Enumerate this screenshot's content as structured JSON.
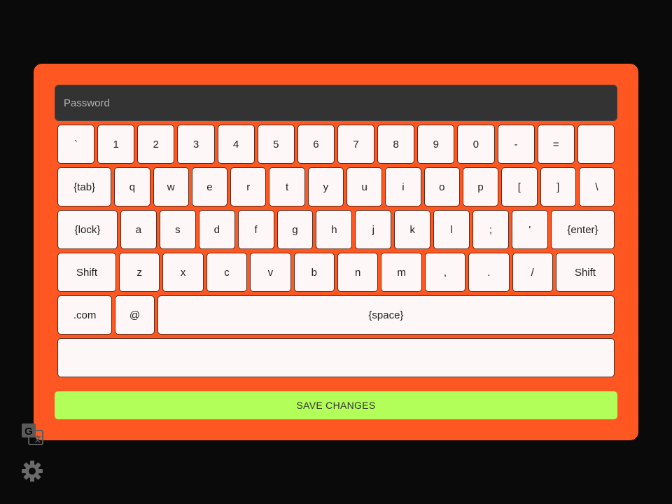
{
  "password": {
    "placeholder": "Password"
  },
  "keyboard": {
    "rows": [
      [
        {
          "label": "`",
          "w": 1
        },
        {
          "label": "1",
          "w": 1
        },
        {
          "label": "2",
          "w": 1
        },
        {
          "label": "3",
          "w": 1
        },
        {
          "label": "4",
          "w": 1
        },
        {
          "label": "5",
          "w": 1
        },
        {
          "label": "6",
          "w": 1
        },
        {
          "label": "7",
          "w": 1
        },
        {
          "label": "8",
          "w": 1
        },
        {
          "label": "9",
          "w": 1
        },
        {
          "label": "0",
          "w": 1
        },
        {
          "label": "-",
          "w": 1
        },
        {
          "label": "=",
          "w": 1
        },
        {
          "label": "",
          "w": 1
        }
      ],
      [
        {
          "label": "{tab}",
          "w": 1.45
        },
        {
          "label": "q",
          "w": 0.95
        },
        {
          "label": "w",
          "w": 0.95
        },
        {
          "label": "e",
          "w": 0.95
        },
        {
          "label": "r",
          "w": 0.95
        },
        {
          "label": "t",
          "w": 0.95
        },
        {
          "label": "y",
          "w": 0.95
        },
        {
          "label": "u",
          "w": 0.95
        },
        {
          "label": "i",
          "w": 0.95
        },
        {
          "label": "o",
          "w": 0.95
        },
        {
          "label": "p",
          "w": 0.95
        },
        {
          "label": "[",
          "w": 0.95
        },
        {
          "label": "]",
          "w": 0.95
        },
        {
          "label": "\\",
          "w": 0.95
        }
      ],
      [
        {
          "label": "{lock}",
          "w": 1.6
        },
        {
          "label": "a",
          "w": 0.95
        },
        {
          "label": "s",
          "w": 0.95
        },
        {
          "label": "d",
          "w": 0.95
        },
        {
          "label": "f",
          "w": 0.95
        },
        {
          "label": "g",
          "w": 0.95
        },
        {
          "label": "h",
          "w": 0.95
        },
        {
          "label": "j",
          "w": 0.95
        },
        {
          "label": "k",
          "w": 0.95
        },
        {
          "label": "l",
          "w": 0.95
        },
        {
          "label": ";",
          "w": 0.95
        },
        {
          "label": "'",
          "w": 0.95
        },
        {
          "label": "{enter}",
          "w": 1.7
        }
      ],
      [
        {
          "label": "Shift",
          "w": 1.6
        },
        {
          "label": "z",
          "w": 1.1
        },
        {
          "label": "x",
          "w": 1.1
        },
        {
          "label": "c",
          "w": 1.1
        },
        {
          "label": "v",
          "w": 1.1
        },
        {
          "label": "b",
          "w": 1.1
        },
        {
          "label": "n",
          "w": 1.1
        },
        {
          "label": "m",
          "w": 1.1
        },
        {
          "label": ",",
          "w": 1.1
        },
        {
          "label": ".",
          "w": 1.1
        },
        {
          "label": "/",
          "w": 1.1
        },
        {
          "label": "Shift",
          "w": 1.6
        }
      ],
      [
        {
          "label": ".com",
          "w": 1.4
        },
        {
          "label": "@",
          "w": 1
        },
        {
          "label": "{space}",
          "w": 11.95
        }
      ],
      [
        {
          "label": "",
          "w": 1
        }
      ]
    ]
  },
  "save_button": {
    "label": "SAVE CHANGES"
  },
  "icons": {
    "translate": "translate-icon",
    "settings": "gear-icon",
    "translate_glyph": "G"
  },
  "colors": {
    "background": "#0a0a0a",
    "panel": "#ff5722",
    "key": "#fdf7f7",
    "save": "#b2ff59",
    "input": "#333333"
  }
}
